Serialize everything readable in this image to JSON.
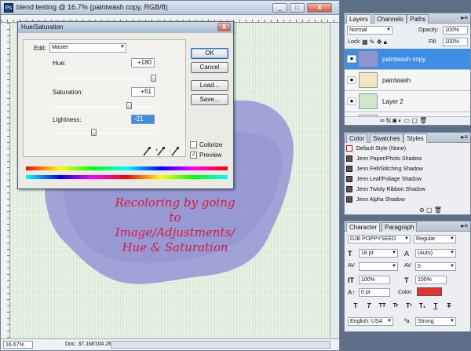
{
  "document": {
    "title": "blend testing @ 16.7% (paintwash copy, RGB/8)",
    "app_icon": "Ps",
    "window_buttons": [
      "_",
      "□",
      "X"
    ],
    "zoom": "16.67%",
    "doc_info": "Doc: 37.1M/104.2M"
  },
  "annotation": {
    "lines": [
      "Recoloring by going",
      "to",
      "Image/Adjustments/",
      "Hue & Saturation"
    ]
  },
  "dialog": {
    "title": "Hue/Saturation",
    "close": "X",
    "edit_label": "Edit:",
    "edit_value": "Master",
    "hue_label": "Hue:",
    "hue_value": "+180",
    "hue_level": 1.0,
    "saturation_label": "Saturation:",
    "saturation_value": "+51",
    "saturation_level": 0.755,
    "lightness_label": "Lightness:",
    "lightness_value": "-21",
    "lightness_level": 0.395,
    "ok": "OK",
    "cancel": "Cancel",
    "load": "Load...",
    "save": "Save...",
    "colorize": "Colorize",
    "colorize_checked": false,
    "preview": "Preview",
    "preview_checked": true
  },
  "layers_panel": {
    "tabs": [
      "Layers",
      "Channels",
      "Paths"
    ],
    "menu": "▸≡",
    "blend_mode": "Normal",
    "opacity_label": "Opacity:",
    "opacity": "100%",
    "lock_label": "Lock:",
    "fill_label": "Fill:",
    "fill": "100%",
    "layers": [
      {
        "name": "paintwash copy",
        "selected": true,
        "thumb": "#8e95d0"
      },
      {
        "name": "paintwash",
        "selected": false,
        "thumb": "#f1e7c2"
      },
      {
        "name": "Layer 2",
        "selected": false,
        "thumb": "#cfe8c9"
      },
      {
        "name": "",
        "selected": false,
        "thumb": "#e9e6dc"
      }
    ]
  },
  "styles_panel": {
    "tabs": [
      "Color",
      "Swatches",
      "Styles"
    ],
    "menu": "▸≡",
    "items": [
      "Default Style (None)",
      "Jenn Paper/Photo Shadow",
      "Jenn Felt/Stitching Shadow",
      "Jenn Leaf/Foliage Shadow",
      "Jenn Twisty Ribbon Shadow",
      "Jenn Alpha Shadow"
    ]
  },
  "character_panel": {
    "tabs": [
      "Character",
      "Paragraph"
    ],
    "menu": "▸≡",
    "font_family": "DJB POPPYSEED",
    "font_style": "Regular",
    "font_size": "18 pt",
    "leading": "(Auto)",
    "kerning": "",
    "tracking": "0",
    "vertical_scale": "100%",
    "horizontal_scale": "100%",
    "baseline_shift": "0 pt",
    "color_label": "Color:",
    "color": "#e8312f",
    "type_buttons": [
      "T",
      "T",
      "TT",
      "Tr",
      "T¹",
      "T₁",
      "T",
      "T"
    ],
    "language": "English: USA",
    "aa_label": "ªa",
    "antialias": "Strong"
  },
  "colors": {
    "canvas": "#e2efdf",
    "paint": "#9a9cd6",
    "annotation": "#d8183a",
    "selection": "#3e8ee6"
  }
}
